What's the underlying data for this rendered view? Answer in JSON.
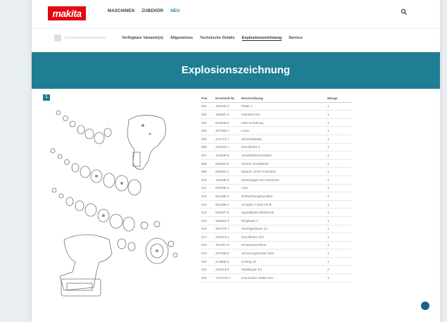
{
  "brand": {
    "logo_text": "makita",
    "color": "#e30613"
  },
  "nav": {
    "items": [
      {
        "label": "MASCHINEN",
        "active": false
      },
      {
        "label": "ZUBEHÖR",
        "active": false
      },
      {
        "label": "NEU",
        "active": true
      }
    ]
  },
  "subnav": {
    "items": [
      {
        "label": "Verfügbare Variante(n)",
        "active": false
      },
      {
        "label": "Allgemeines",
        "active": false
      },
      {
        "label": "Technische Details",
        "active": false
      },
      {
        "label": "Explosionszeichnung",
        "active": true
      },
      {
        "label": "Service",
        "active": false
      }
    ]
  },
  "banner": {
    "title": "Explosionszeichnung",
    "color": "#1f7e93"
  },
  "diagram": {
    "page_label": "1"
  },
  "table": {
    "headers": {
      "pos": "Pos",
      "number": "Ersatzteil-Nr.",
      "description": "Beschreibung",
      "qty": "Menge"
    },
    "rows": [
      {
        "pos": "001",
        "number": "183103-3",
        "description": "Platte 1",
        "qty": "1"
      },
      {
        "pos": "002",
        "number": "183087-3",
        "description": "Getriebe-Set",
        "qty": "1"
      },
      {
        "pos": "003",
        "number": "620609-5",
        "description": "LED-Schaltung",
        "qty": "1"
      },
      {
        "pos": "004",
        "number": "267365-7",
        "description": "Linse",
        "qty": "1"
      },
      {
        "pos": "005",
        "number": "414713-7",
        "description": "Wechselplatte",
        "qty": "1"
      },
      {
        "pos": "006",
        "number": "226420-1",
        "description": "Druckfeder 2",
        "qty": "1"
      },
      {
        "pos": "007",
        "number": "144536-8",
        "description": "Schalthebel komplett",
        "qty": "1"
      },
      {
        "pos": "008",
        "number": "620361-6",
        "description": "Sensor-Schaltkreis",
        "qty": "1"
      },
      {
        "pos": "009",
        "number": "650262-2",
        "description": "Bauteil: LEW-Anschluss",
        "qty": "1"
      },
      {
        "pos": "010",
        "number": "144398-6",
        "description": "Motorkappe mit Anschluss",
        "qty": "1"
      },
      {
        "pos": "011",
        "number": "635385-3",
        "description": "LED",
        "qty": "1"
      },
      {
        "pos": "012",
        "number": "651985-3",
        "description": "Drehrichtungsschalter",
        "qty": "1"
      },
      {
        "pos": "013",
        "number": "651096-1",
        "description": "Schalter C3JW-1R-B",
        "qty": "1"
      },
      {
        "pos": "014",
        "number": "620637-8",
        "description": "Signalgeber-Elektronik",
        "qty": "1"
      },
      {
        "pos": "015",
        "number": "258663-3",
        "description": "Ringfeder 4",
        "qty": "1"
      },
      {
        "pos": "016",
        "number": "267370-1",
        "description": "Verteilgehäuse 10",
        "qty": "1"
      },
      {
        "pos": "017",
        "number": "233373-4",
        "description": "Druckfeder 10A",
        "qty": "1"
      },
      {
        "pos": "018",
        "number": "761367-9",
        "description": "Einsteckachslinie",
        "qty": "1"
      },
      {
        "pos": "019",
        "number": "267406-9",
        "description": "Sicherungsmutter M10",
        "qty": "1"
      },
      {
        "pos": "020",
        "number": "213686-5",
        "description": "O-Ring 20",
        "qty": "1"
      },
      {
        "pos": "021",
        "number": "216013-6",
        "description": "Stahlkugel 3,5",
        "qty": "2"
      },
      {
        "pos": "022",
        "number": "7704744-7",
        "description": "Kreuzzahn 10080 mm",
        "qty": "1"
      }
    ]
  }
}
